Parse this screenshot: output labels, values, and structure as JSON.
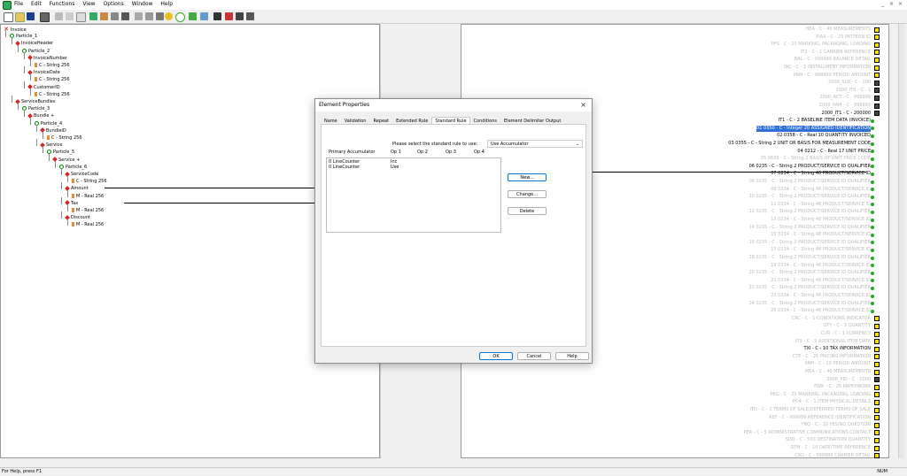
{
  "menubar": {
    "items": [
      "File",
      "Edit",
      "Functions",
      "View",
      "Options",
      "Window",
      "Help"
    ],
    "window_buttons": [
      "_",
      "×",
      "×"
    ]
  },
  "tree": [
    {
      "label": "Invoice",
      "icon": "x",
      "depth": 0
    },
    {
      "label": "Particle_1",
      "icon": "p",
      "depth": 1
    },
    {
      "label": "InvoiceHeader",
      "icon": "d",
      "depth": 2
    },
    {
      "label": "Particle_2",
      "icon": "p",
      "depth": 3
    },
    {
      "label": "InvoiceNumber",
      "icon": "d",
      "depth": 4
    },
    {
      "label": "C - String 256",
      "icon": "l",
      "depth": 5
    },
    {
      "label": "InvoiceDate",
      "icon": "d",
      "depth": 4
    },
    {
      "label": "C - String 256",
      "icon": "l",
      "depth": 5
    },
    {
      "label": "CustomerID",
      "icon": "d",
      "depth": 4
    },
    {
      "label": "C - String 256",
      "icon": "l",
      "depth": 5
    },
    {
      "label": "ServiceBundles",
      "icon": "d",
      "depth": 2
    },
    {
      "label": "Particle_3",
      "icon": "p",
      "depth": 3
    },
    {
      "label": "Bundle +",
      "icon": "d",
      "depth": 4
    },
    {
      "label": "Particle_4",
      "icon": "p",
      "depth": 5
    },
    {
      "label": "BundleID",
      "icon": "d",
      "depth": 6
    },
    {
      "label": "C - String 256",
      "icon": "l",
      "depth": 7
    },
    {
      "label": "Service",
      "icon": "d",
      "depth": 6
    },
    {
      "label": "Particle_5",
      "icon": "p",
      "depth": 7
    },
    {
      "label": "Service +",
      "icon": "d",
      "depth": 8
    },
    {
      "label": "Particle_6",
      "icon": "p",
      "depth": 9
    },
    {
      "label": "ServiceCode",
      "icon": "d",
      "depth": 10
    },
    {
      "label": "C - String 256",
      "icon": "l",
      "depth": 11
    },
    {
      "label": "Amount",
      "icon": "d",
      "depth": 10
    },
    {
      "label": "M - Real 256",
      "icon": "l",
      "depth": 11
    },
    {
      "label": "Tax",
      "icon": "d",
      "depth": 10
    },
    {
      "label": "M - Real 256",
      "icon": "l",
      "depth": 11
    },
    {
      "label": "Discount",
      "icon": "d",
      "depth": 10
    },
    {
      "label": "M - Real 256",
      "icon": "l",
      "depth": 11
    }
  ],
  "right_rows": [
    {
      "text": "HEA - C - 40 MEASUREMENTS",
      "style": "faint",
      "box": "y"
    },
    {
      "text": "PIAX - C - 25 PATTERN ID",
      "style": "faint",
      "box": "y"
    },
    {
      "text": "PFS - C - 25 MARKING, PACKAGING, LOADING",
      "style": "faint",
      "box": "y"
    },
    {
      "text": "IT2 - C - 1 CARRIER REFERENCE",
      "style": "faint",
      "box": "y"
    },
    {
      "text": "BAL - C - 999999 BALANCE DETAIL",
      "style": "faint",
      "box": "y"
    },
    {
      "text": "INC - C - 1 INSTALLMENT INFORMATION",
      "style": "faint",
      "box": "y"
    },
    {
      "text": "PAM - C - 999999 PERIOD AMOUNT",
      "style": "faint",
      "box": "y"
    },
    {
      "text": "2000_SLN - C - 100",
      "style": "faint",
      "box": "d"
    },
    {
      "text": "2000_IT8 - C - 1",
      "style": "faint",
      "box": "d"
    },
    {
      "text": "2000_ACT - C - 999999",
      "style": "faint",
      "box": "d"
    },
    {
      "text": "2000_PAM - C - 999999",
      "style": "faint",
      "box": "d"
    },
    {
      "text": "2000_IT1 - C - 200000",
      "style": "dark",
      "box": "d"
    },
    {
      "text": "IT1 - C - 2 BASELINE ITEM DATA (INVOICE)",
      "style": "dark",
      "box": "g"
    },
    {
      "text": "01 0350 - C - Integer 20 ASSIGNED IDENTIFICATION",
      "style": "hl",
      "box": "g"
    },
    {
      "text": "02 0358 - C - Real 10 QUANTITY INVOICED",
      "style": "dark",
      "box": "g"
    },
    {
      "text": "03 0355 - C - String 2 UNIT OR BASIS FOR MEASUREMENT CODE",
      "style": "dark",
      "box": "g"
    },
    {
      "text": "04 0212 - C - Real 17 UNIT PRICE",
      "style": "dark",
      "box": "g"
    },
    {
      "text": "05 0639 - C - String 2 BASIS OF UNIT PRICE CODE",
      "style": "faint",
      "box": "g"
    },
    {
      "text": "06 0235 - C - String 2 PRODUCT/SERVICE ID QUALIFIER",
      "style": "dark",
      "box": "g"
    },
    {
      "text": "07 0234 - C - String 48 PRODUCT/SERVICE ID",
      "style": "dark",
      "box": "g"
    },
    {
      "text": "08 0235 - C - String 2 PRODUCT/SERVICE ID QUALIFIER",
      "style": "faint",
      "box": "g"
    },
    {
      "text": "09 0234 - C - String 48 PRODUCT/SERVICE ID",
      "style": "faint",
      "box": "g"
    },
    {
      "text": "10 0235 - C - String 2 PRODUCT/SERVICE ID QUALIFIER",
      "style": "faint",
      "box": "g"
    },
    {
      "text": "11 0234 - C - String 48 PRODUCT/SERVICE ID",
      "style": "faint",
      "box": "g"
    },
    {
      "text": "12 0235 - C - String 2 PRODUCT/SERVICE ID QUALIFIER",
      "style": "faint",
      "box": "g"
    },
    {
      "text": "13 0234 - C - String 48 PRODUCT/SERVICE ID",
      "style": "faint",
      "box": "g"
    },
    {
      "text": "14 0235 - C - String 2 PRODUCT/SERVICE ID QUALIFIER",
      "style": "faint",
      "box": "g"
    },
    {
      "text": "15 0234 - C - String 48 PRODUCT/SERVICE ID",
      "style": "faint",
      "box": "g"
    },
    {
      "text": "16 0235 - C - String 2 PRODUCT/SERVICE ID QUALIFIER",
      "style": "faint",
      "box": "g"
    },
    {
      "text": "17 0234 - C - String 48 PRODUCT/SERVICE ID",
      "style": "faint",
      "box": "g"
    },
    {
      "text": "18 0235 - C - String 2 PRODUCT/SERVICE ID QUALIFIER",
      "style": "faint",
      "box": "g"
    },
    {
      "text": "19 0234 - C - String 48 PRODUCT/SERVICE ID",
      "style": "faint",
      "box": "g"
    },
    {
      "text": "20 0235 - C - String 2 PRODUCT/SERVICE ID QUALIFIER",
      "style": "faint",
      "box": "g"
    },
    {
      "text": "21 0234 - C - String 48 PRODUCT/SERVICE ID",
      "style": "faint",
      "box": "g"
    },
    {
      "text": "22 0235 - C - String 2 PRODUCT/SERVICE ID QUALIFIER",
      "style": "faint",
      "box": "g"
    },
    {
      "text": "23 0234 - C - String 48 PRODUCT/SERVICE ID",
      "style": "faint",
      "box": "g"
    },
    {
      "text": "24 0235 - C - String 2 PRODUCT/SERVICE ID QUALIFIER",
      "style": "faint",
      "box": "g"
    },
    {
      "text": "25 0234 - C - String 48 PRODUCT/SERVICE ID",
      "style": "faint",
      "box": "g"
    },
    {
      "text": "CRC - C - 1 CONDITIONS INDICATOR",
      "style": "faint",
      "box": "y"
    },
    {
      "text": "QTY - C - 5 QUANTITY",
      "style": "faint",
      "box": "y"
    },
    {
      "text": "CUR - C - 1 CURRENCY",
      "style": "faint",
      "box": "y"
    },
    {
      "text": "IT3 - C - 5 ADDITIONAL ITEM DATA",
      "style": "faint",
      "box": "y"
    },
    {
      "text": "TXI - C - 10 TAX INFORMATION",
      "style": "dark",
      "box": "y"
    },
    {
      "text": "CTP - C - 25 PRICING INFORMATION",
      "style": "faint",
      "box": "y"
    },
    {
      "text": "PAM - C - 10 PERIOD AMOUNT",
      "style": "faint",
      "box": "y"
    },
    {
      "text": "MEA - C - 40 MEASUREMENTS",
      "style": "faint",
      "box": "y"
    },
    {
      "text": "2000_PID - C - 1000",
      "style": "faint",
      "box": "d"
    },
    {
      "text": "PWK - C - 25 PAPERWORK",
      "style": "faint",
      "box": "y"
    },
    {
      "text": "PKG - C - 25 MARKING, PACKAGING, LOADING",
      "style": "faint",
      "box": "y"
    },
    {
      "text": "PO4 - C - 1 ITEM PHYSICAL DETAILS",
      "style": "faint",
      "box": "y"
    },
    {
      "text": "ITD - C - 2 TERMS OF SALE/DEFERRED TERMS OF SALE",
      "style": "faint",
      "box": "y"
    },
    {
      "text": "REF - C - 999999 REFERENCE IDENTIFICATION",
      "style": "faint",
      "box": "y"
    },
    {
      "text": "YNQ - C - 10 YES/NO QUESTION",
      "style": "faint",
      "box": "y"
    },
    {
      "text": "PER - C - 5 ADMINISTRATIVE COMMUNICATIONS CONTACT",
      "style": "faint",
      "box": "y"
    },
    {
      "text": "SDQ - C - 500 DESTINATION QUANTITY",
      "style": "faint",
      "box": "y"
    },
    {
      "text": "DTM - C - 10 DATE/TIME REFERENCE",
      "style": "faint",
      "box": "y"
    },
    {
      "text": "CAD - C - 999999 CARRIER DETAIL",
      "style": "faint",
      "box": "y"
    }
  ],
  "dialog": {
    "title": "Element Properties",
    "close": "×",
    "tabs": [
      "Name",
      "Validation",
      "Repeat",
      "Extended Rule",
      "Standard Rule",
      "Conditions",
      "Element Delimiter Output"
    ],
    "active_tab": 4,
    "prompt": "Please select the standard rule to use:",
    "rule_value": "Use Accumulator",
    "columns": [
      "Primary Accumulator",
      "Op 1",
      "Op 2",
      "Op 3",
      "Op 4"
    ],
    "rows": [
      [
        "0 LineCounter",
        "Inc",
        "",
        "",
        ""
      ],
      [
        "0 LineCounter",
        "Use",
        "",
        "",
        ""
      ]
    ],
    "side_buttons": [
      "New...",
      "Change...",
      "Delete"
    ],
    "bottom_buttons": [
      "OK",
      "Cancel",
      "Help"
    ]
  },
  "status": {
    "left": "For Help, press F1",
    "right": "NUM"
  },
  "colors": {
    "highlight": "#2f6fd6",
    "box_yellow": "#f5e000",
    "box_green": "#22aa22",
    "box_dark": "#444444"
  }
}
